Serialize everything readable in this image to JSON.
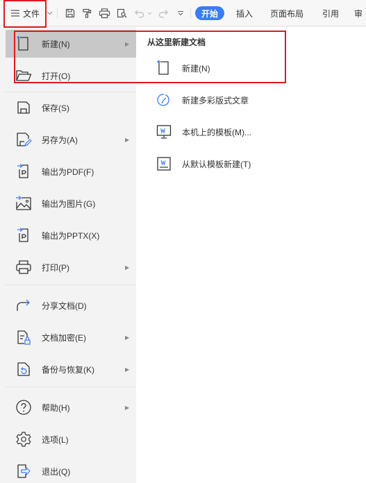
{
  "toolbar": {
    "file_label": "文件",
    "tabs": [
      "开始",
      "插入",
      "页面布局",
      "引用",
      "审"
    ],
    "active_tab_color": "#3a7cf2",
    "icons": [
      "hamburger-icon",
      "chevron-down-icon",
      "save-icon",
      "format-painter-icon",
      "print-icon",
      "print-preview-icon",
      "undo-icon",
      "redo-icon",
      "more-icon"
    ]
  },
  "menu": {
    "items": [
      {
        "label": "新建(N)",
        "icon": "new-document-icon",
        "submenu": true,
        "highlighted": true
      },
      {
        "label": "打开(O)",
        "icon": "folder-icon",
        "submenu": false
      },
      {
        "label": "保存(S)",
        "icon": "save-icon",
        "submenu": false
      },
      {
        "label": "另存为(A)",
        "icon": "save-as-icon",
        "submenu": true
      },
      {
        "label": "输出为PDF(F)",
        "icon": "export-pdf-icon",
        "submenu": false
      },
      {
        "label": "输出为图片(G)",
        "icon": "export-image-icon",
        "submenu": false
      },
      {
        "label": "输出为PPTX(X)",
        "icon": "export-pptx-icon",
        "submenu": false
      },
      {
        "label": "打印(P)",
        "icon": "print-icon",
        "submenu": true
      },
      {
        "label": "分享文档(D)",
        "icon": "share-icon",
        "submenu": false
      },
      {
        "label": "文档加密(E)",
        "icon": "encrypt-icon",
        "submenu": true
      },
      {
        "label": "备份与恢复(K)",
        "icon": "backup-icon",
        "submenu": true
      },
      {
        "label": "帮助(H)",
        "icon": "help-icon",
        "submenu": true
      },
      {
        "label": "选项(L)",
        "icon": "gear-icon",
        "submenu": false
      },
      {
        "label": "退出(Q)",
        "icon": "exit-icon",
        "submenu": false
      }
    ]
  },
  "submenu": {
    "title": "从这里新建文档",
    "items": [
      {
        "label": "新建(N)",
        "icon": "new-document-icon"
      },
      {
        "label": "新建多彩版式文章",
        "icon": "colorful-article-icon"
      },
      {
        "label": "本机上的模板(M)...",
        "icon": "local-template-icon"
      },
      {
        "label": "从默认模板新建(T)",
        "icon": "default-template-icon"
      }
    ]
  },
  "colors": {
    "accent": "#3a7cf2",
    "highlight_box": "#e0191f"
  }
}
